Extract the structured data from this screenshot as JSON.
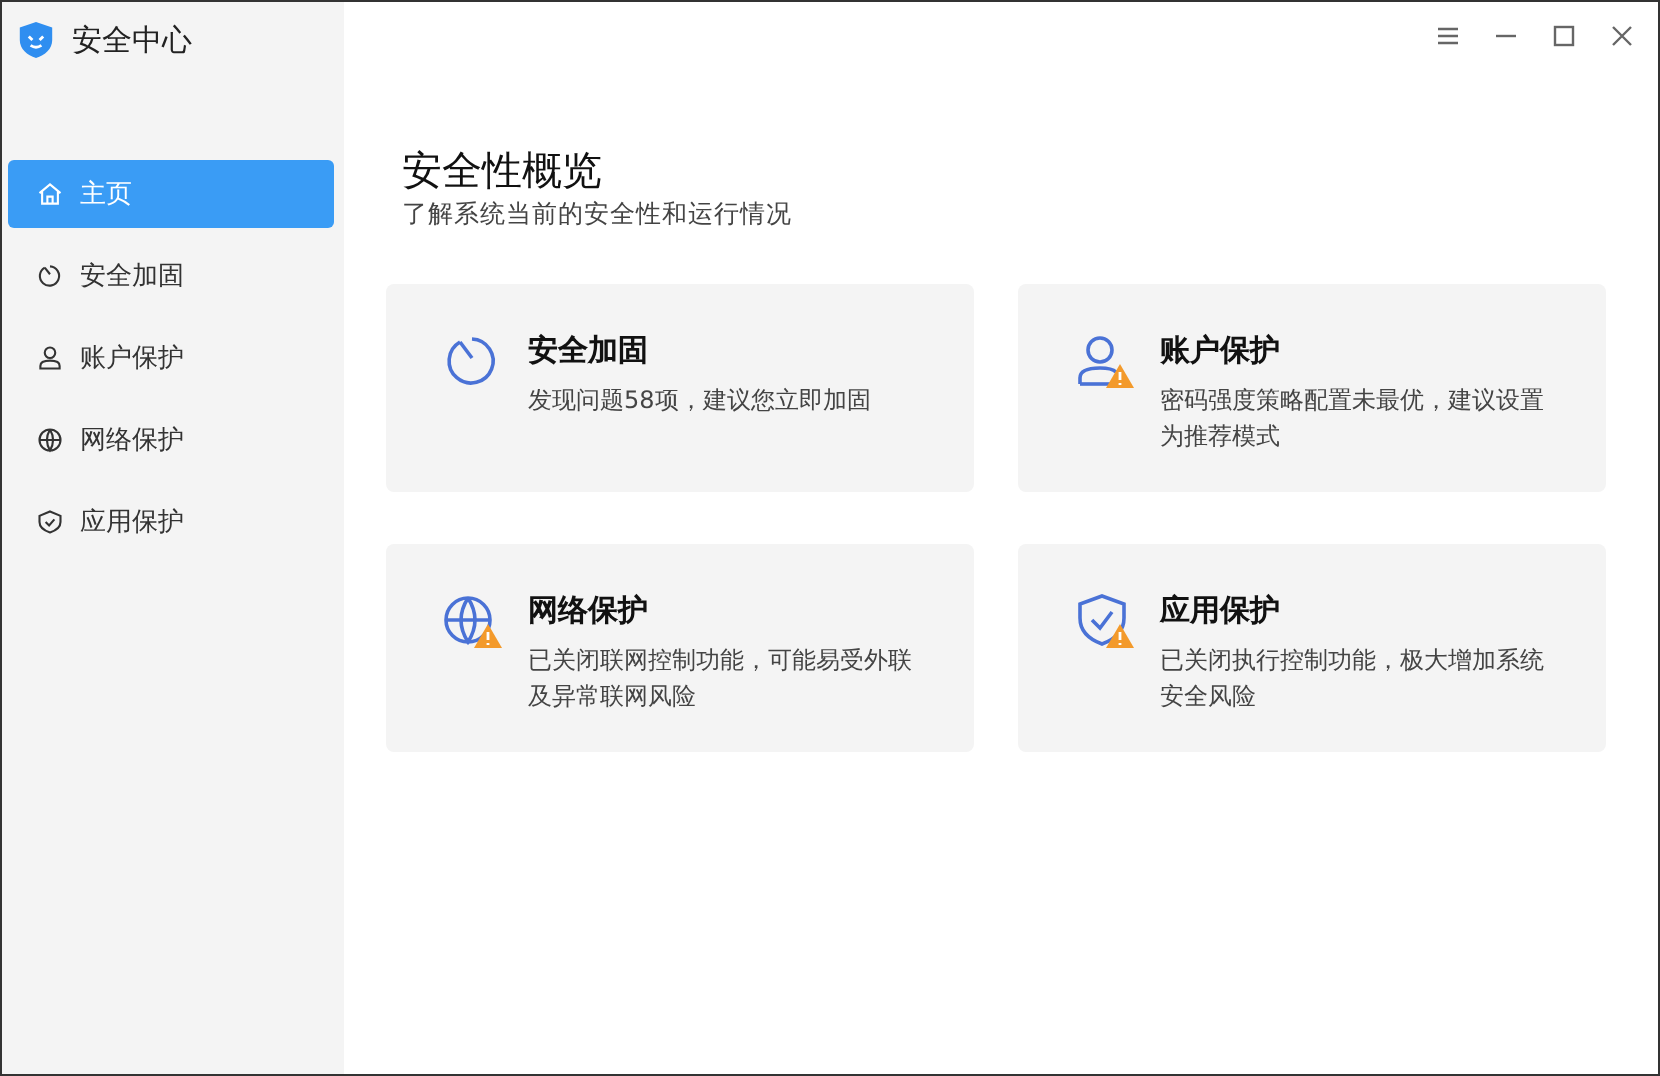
{
  "app": {
    "title": "安全中心"
  },
  "sidebar": {
    "items": [
      {
        "label": "主页",
        "kind": "home",
        "selected": true
      },
      {
        "label": "安全加固",
        "kind": "reinforce",
        "selected": false
      },
      {
        "label": "账户保护",
        "kind": "account",
        "selected": false
      },
      {
        "label": "网络保护",
        "kind": "network",
        "selected": false
      },
      {
        "label": "应用保护",
        "kind": "app",
        "selected": false
      }
    ]
  },
  "overview": {
    "title": "安全性概览",
    "subtitle": "了解系统当前的安全性和运行情况"
  },
  "cards": [
    {
      "kind": "reinforce",
      "warning": false,
      "title": "安全加固",
      "description": "发现问题58项，建议您立即加固"
    },
    {
      "kind": "account",
      "warning": true,
      "title": "账户保护",
      "description": "密码强度策略配置未最优，建议设置为推荐模式"
    },
    {
      "kind": "network",
      "warning": true,
      "title": "网络保护",
      "description": "已关闭联网控制功能，可能易受外联及异常联网风险"
    },
    {
      "kind": "app",
      "warning": true,
      "title": "应用保护",
      "description": "已关闭执行控制功能，极大增加系统安全风险"
    }
  ]
}
